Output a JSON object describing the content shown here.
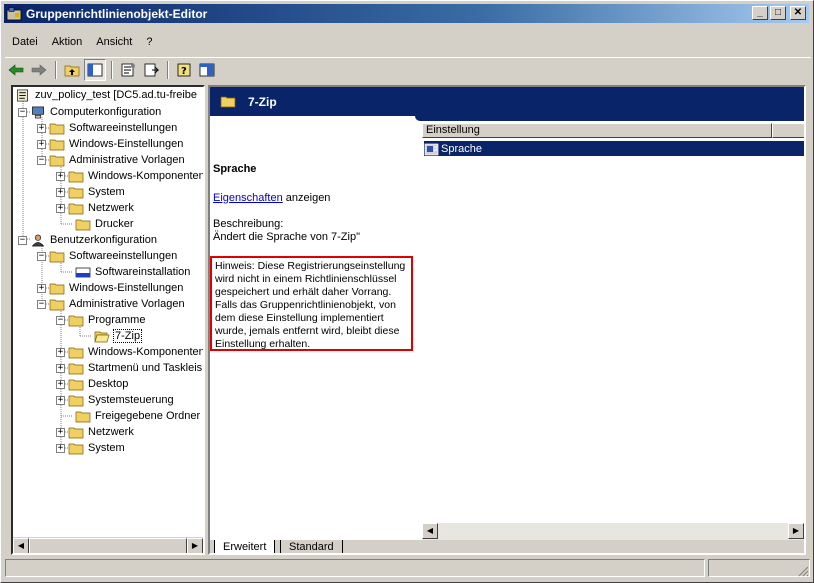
{
  "window": {
    "title": "Gruppenrichtlinienobjekt-Editor",
    "min_label": "_",
    "max_label": "□",
    "close_label": "✕"
  },
  "menu": {
    "items": [
      "Datei",
      "Aktion",
      "Ansicht",
      "?"
    ]
  },
  "tree": {
    "root": "zuv_policy_test [DC5.ad.tu-freibe",
    "items": [
      {
        "label": "Computerkonfiguration"
      },
      {
        "label": "Softwareeinstellungen"
      },
      {
        "label": "Windows-Einstellungen"
      },
      {
        "label": "Administrative Vorlagen"
      },
      {
        "label": "Windows-Komponenten"
      },
      {
        "label": "System"
      },
      {
        "label": "Netzwerk"
      },
      {
        "label": "Drucker"
      },
      {
        "label": "Benutzerkonfiguration"
      },
      {
        "label": "Softwareeinstellungen"
      },
      {
        "label": "Softwareinstallation"
      },
      {
        "label": "Windows-Einstellungen"
      },
      {
        "label": "Administrative Vorlagen"
      },
      {
        "label": "Programme"
      },
      {
        "label": "7-Zip"
      },
      {
        "label": "Windows-Komponenten"
      },
      {
        "label": "Startmenü und Taskleis"
      },
      {
        "label": "Desktop"
      },
      {
        "label": "Systemsteuerung"
      },
      {
        "label": "Freigegebene Ordner"
      },
      {
        "label": "Netzwerk"
      },
      {
        "label": "System"
      }
    ]
  },
  "details": {
    "header": "7-Zip",
    "setting_title": "Sprache",
    "link_text": "Eigenschaften",
    "link_suffix": " anzeigen",
    "desc_label": "Beschreibung:",
    "desc_text": "Ändert die Sprache von 7-Zip\"",
    "hint": "Hinweis: Diese Registrierungseinstellung wird nicht in einem Richtlinienschlüssel gespeichert und erhält daher Vorrang. Falls das Gruppenrichtlinienobjekt, von dem diese Einstellung implementiert wurde, jemals entfernt wird, bleibt diese Einstellung erhalten."
  },
  "list": {
    "column": "Einstellung",
    "rows": [
      "Sprache"
    ]
  },
  "tabs": [
    "Erweitert",
    "Standard"
  ],
  "colors": {
    "title_gradient_start": "#0a246a",
    "selection": "#0a246a",
    "hint_border": "#e00000",
    "link": "#0000cc"
  }
}
